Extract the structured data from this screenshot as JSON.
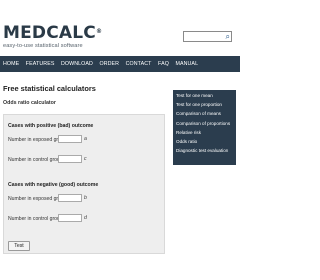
{
  "header": {
    "logo_text": "MEDCALC",
    "logo_mark": "®",
    "tagline": "easy-to-use statistical software",
    "search": {
      "placeholder": "",
      "icon": "search-icon"
    }
  },
  "nav": {
    "items": [
      {
        "label": "HOME"
      },
      {
        "label": "FEATURES"
      },
      {
        "label": "DOWNLOAD"
      },
      {
        "label": "ORDER"
      },
      {
        "label": "CONTACT"
      },
      {
        "label": "FAQ"
      },
      {
        "label": "MANUAL"
      }
    ]
  },
  "main": {
    "title": "Free statistical calculators",
    "subtitle": "Odds ratio calculator",
    "positive_section": {
      "label": "Cases with positive (bad) outcome",
      "exposed_label": "Number in exposed group:",
      "exposed_value": "",
      "exposed_suffix": "a",
      "control_label": "Number in control group:",
      "control_value": "",
      "control_suffix": "c"
    },
    "negative_section": {
      "label": "Cases with negative (good) outcome",
      "exposed_label": "Number in exposed group:",
      "exposed_value": "",
      "exposed_suffix": "b",
      "control_label": "Number in control group:",
      "control_value": "",
      "control_suffix": "d"
    },
    "test_button": "Test"
  },
  "side_menu": {
    "items": [
      {
        "label": "Test for one mean"
      },
      {
        "label": "Test for one proportion"
      },
      {
        "label": "Comparison of means"
      },
      {
        "label": "Comparison of proportions"
      },
      {
        "label": "Relative risk"
      },
      {
        "label": "Odds ratio"
      },
      {
        "label": "Diagnostic test evaluation"
      }
    ]
  },
  "colors": {
    "nav_background": "#2b3d4e",
    "panel_background": "#eeeeee",
    "logo_text": "#2a3a47"
  }
}
